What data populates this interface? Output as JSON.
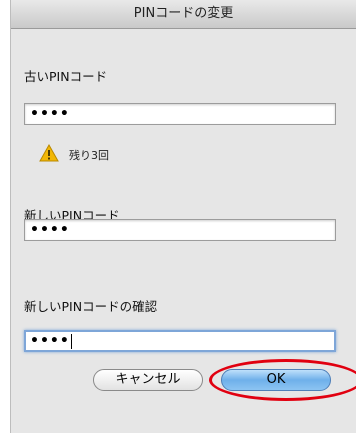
{
  "dialog": {
    "title": "PINコードの変更"
  },
  "old_pin": {
    "label": "古いPINコード",
    "value": "••••"
  },
  "warning": {
    "text": "残り3回",
    "icon": "warning-triangle-icon",
    "icon_color": "#f2b705"
  },
  "new_pin": {
    "label": "新しいPINコード",
    "value": "••••"
  },
  "confirm_pin": {
    "label": "新しいPINコードの確認",
    "value": "••••"
  },
  "buttons": {
    "cancel_label": "キャンセル",
    "ok_label": "OK"
  },
  "annotation": {
    "color": "#e10010"
  }
}
